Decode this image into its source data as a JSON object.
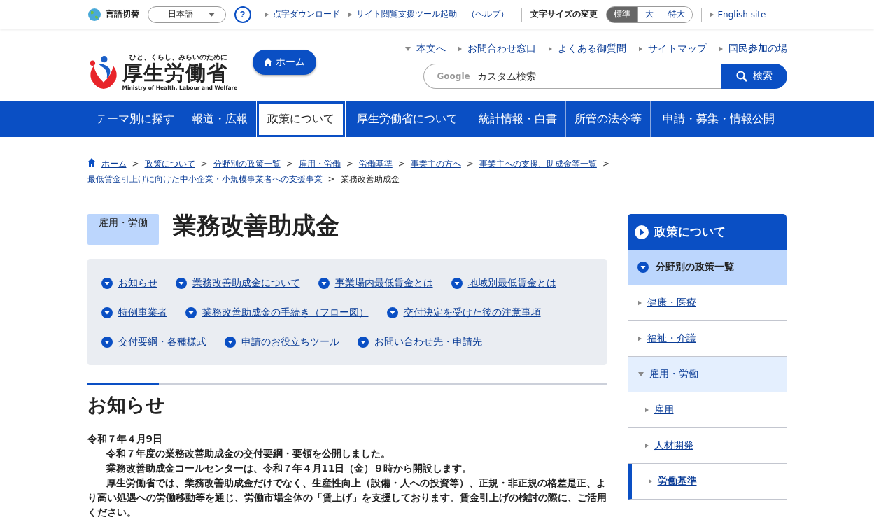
{
  "utility_bar": {
    "language_label": "言語切替",
    "language_select": "日本語",
    "help_button": "?",
    "links": [
      "点字ダウンロード",
      "サイト閲覧支援ツール起動"
    ],
    "help_link": "（ヘルプ）",
    "font_size_label": "文字サイズの変更",
    "font_sizes": [
      {
        "label": "標準",
        "selected": true
      },
      {
        "label": "大",
        "selected": false
      },
      {
        "label": "特大",
        "selected": false
      }
    ],
    "english_link": "English site"
  },
  "header": {
    "slogan": "ひと、くらし、みらいのために",
    "ministry_name": "厚生労働省",
    "ministry_name_en": "Ministry of Health, Labour and Welfare",
    "home_button": "ホーム",
    "quick_links": [
      {
        "label": "本文へ",
        "kind": "down"
      },
      {
        "label": "お問合わせ窓口",
        "kind": "right"
      },
      {
        "label": "よくある御質問",
        "kind": "right"
      },
      {
        "label": "サイトマップ",
        "kind": "right"
      },
      {
        "label": "国民参加の場",
        "kind": "right"
      }
    ],
    "search": {
      "provider": "Google",
      "placeholder": "カスタム検索",
      "button": "検索"
    }
  },
  "main_nav": [
    {
      "label": "テーマ別に探す",
      "selected": false
    },
    {
      "label": "報道・広報",
      "selected": false
    },
    {
      "label": "政策について",
      "selected": true
    },
    {
      "label": "厚生労働省について",
      "selected": false
    },
    {
      "label": "統計情報・白書",
      "selected": false
    },
    {
      "label": "所管の法令等",
      "selected": false
    },
    {
      "label": "申請・募集・情報公開",
      "selected": false
    }
  ],
  "breadcrumb": {
    "separator": ">",
    "links": [
      "ホーム",
      "政策について",
      "分野別の政策一覧",
      "雇用・労働",
      "労働基準",
      "事業主の方へ",
      "事業主への支援、助成金等一覧",
      "最低賃金引上げに向けた中小企業・小規模事業者への支援事業"
    ],
    "current": "業務改善助成金"
  },
  "page": {
    "category_tag": "雇用・労働",
    "title": "業務改善助成金",
    "anchor_links": [
      "お知らせ",
      "業務改善助成金について",
      "事業場内最低賃金とは",
      "地域別最低賃金とは",
      "特例事業者",
      "業務改善助成金の手続き（フロー図）",
      "交付決定を受けた後の注意事項",
      "交付要綱・各種様式",
      "申請のお役立ちツール",
      "お問い合わせ先・申請先"
    ],
    "news": {
      "heading": "お知らせ",
      "date": "令和７年４月9日",
      "paragraphs": [
        "令和７年度の業務改善助成金の交付要綱・要領を公開しました。",
        "業務改善助成金コールセンターは、令和７年４月11日（金）９時から開設します。",
        "厚生労働省では、業務改善助成金だけでなく、生産性向上（設備・人への投資等）、正規・非正規の格差是正、より高い処遇への労働移動等を通じ、労働市場全体の「賃上げ」を支援しております。賃金引上げの検討の際に、ご活用ください。"
      ]
    }
  },
  "sidebar": {
    "heading": "政策について",
    "items": [
      {
        "label": "分野別の政策一覧",
        "kind": "section",
        "expanded": true,
        "children": [
          {
            "label": "健康・医療",
            "kind": "link",
            "expanded": false,
            "selected": false
          },
          {
            "label": "福祉・介護",
            "kind": "link",
            "expanded": false,
            "selected": false
          },
          {
            "label": "雇用・労働",
            "kind": "link",
            "expanded": true,
            "selected": false,
            "children": [
              {
                "label": "雇用",
                "kind": "link",
                "expanded": false,
                "selected": false
              },
              {
                "label": "人材開発",
                "kind": "link",
                "expanded": false,
                "selected": false
              },
              {
                "label": "労働基準",
                "kind": "link",
                "expanded": false,
                "selected": true
              }
            ]
          }
        ]
      }
    ]
  }
}
